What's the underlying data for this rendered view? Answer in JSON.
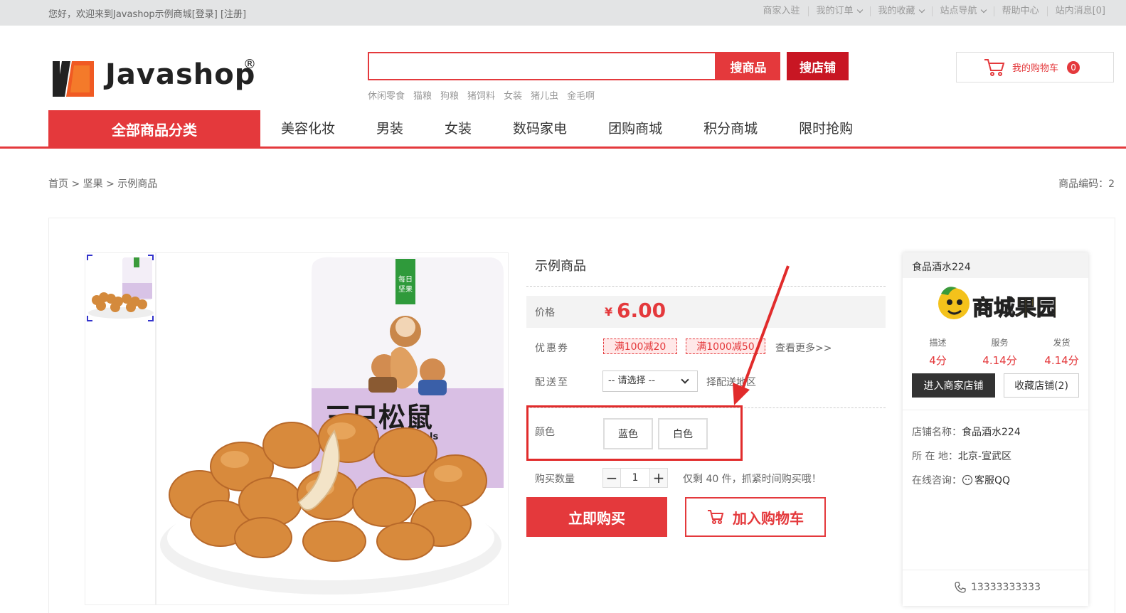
{
  "topbar": {
    "welcome": "您好，欢迎来到Javashop示例商城",
    "login": "[登录]",
    "register": "[注册]",
    "links": [
      "商家入驻",
      "我的订单",
      "我的收藏",
      "站点导航",
      "帮助中心",
      "站内消息[0]"
    ]
  },
  "header": {
    "logo_text": "Javashop",
    "logo_reg": "®",
    "search": {
      "value": "",
      "goods_button": "搜商品",
      "shop_button": "搜店铺"
    },
    "hotwords": [
      "休闲零食",
      "猫粮",
      "狗粮",
      "猪饲料",
      "女装",
      "猪儿虫",
      "金毛啊"
    ],
    "cart": {
      "label": "我的购物车",
      "count": "0"
    }
  },
  "nav": {
    "all_categories": "全部商品分类",
    "items": [
      "美容化妆",
      "男装",
      "女装",
      "数码家电",
      "团购商城",
      "积分商城",
      "限时抢购"
    ]
  },
  "breadcrumb": {
    "home": "首页",
    "sep": ">",
    "cat": "坚果",
    "current": "示例商品"
  },
  "sku_label": "商品编码：2",
  "product": {
    "name": "示例商品",
    "price_label": "价格",
    "currency": "¥",
    "price": "6.00",
    "coupon_label": "优惠券",
    "coupons": [
      "满100减20",
      "满1000减50"
    ],
    "coupon_more": "查看更多>>",
    "delivery_label": "配送至",
    "delivery_select": "-- 请选择 --",
    "delivery_hint": "择配送地区",
    "spec_label": "颜色",
    "specs": [
      "蓝色",
      "白色"
    ],
    "qty_label": "购买数量",
    "qty": "1",
    "stock_text": "仅剩 40 件，抓紧时间购买哦！",
    "buy_now": "立即购买",
    "add_cart": "加入购物车",
    "image_text": "三只松鼠"
  },
  "shop": {
    "name": "食品酒水224",
    "logo_text": "商城果园",
    "stats": [
      {
        "title": "描述",
        "value": "4分"
      },
      {
        "title": "服务",
        "value": "4.14分"
      },
      {
        "title": "发货",
        "value": "4.14分"
      }
    ],
    "enter_button": "进入商家店铺",
    "fav_button": "收藏店铺(2)",
    "info": [
      {
        "key": "店铺名称：",
        "value": "食品酒水224"
      },
      {
        "key": "所 在 地：",
        "value": "北京-宣武区"
      },
      {
        "key": "在线咨询：",
        "value": "客服QQ"
      }
    ],
    "phone": "13333333333"
  },
  "colors": {
    "accent": "#e4393c",
    "dark_red": "#c81623",
    "annotation": "#e12b2b"
  }
}
